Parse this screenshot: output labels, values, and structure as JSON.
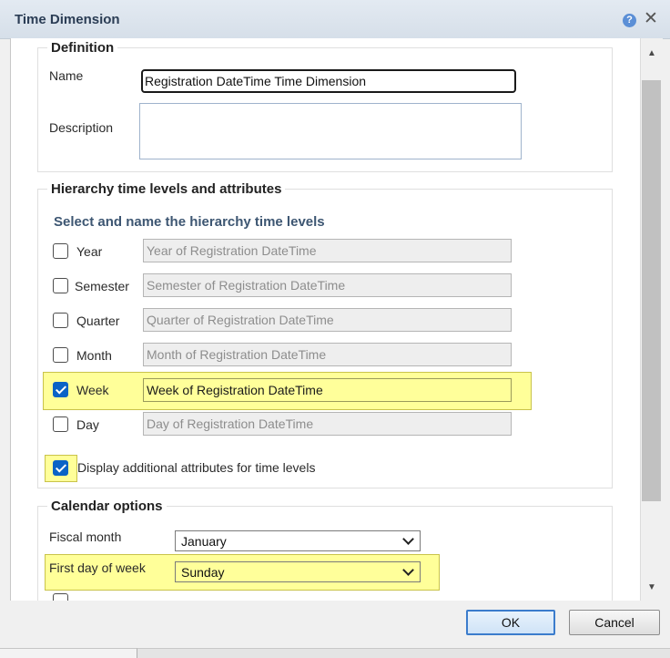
{
  "window": {
    "title": "Time Dimension"
  },
  "definition": {
    "legend": "Definition",
    "name_label": "Name",
    "name_value": "Registration DateTime Time Dimension",
    "description_label": "Description",
    "description_value": ""
  },
  "hierarchy": {
    "legend": "Hierarchy time levels and attributes",
    "subheading": "Select and name the hierarchy time levels",
    "levels": [
      {
        "label": "Year",
        "value": "Year of Registration DateTime",
        "checked": false
      },
      {
        "label": "Semester",
        "value": "Semester of Registration DateTime",
        "checked": false
      },
      {
        "label": "Quarter",
        "value": "Quarter of Registration DateTime",
        "checked": false
      },
      {
        "label": "Month",
        "value": "Month of Registration DateTime",
        "checked": false
      },
      {
        "label": "Week",
        "value": "Week of Registration DateTime",
        "checked": true
      },
      {
        "label": "Day",
        "value": "Day of Registration DateTime",
        "checked": false
      }
    ],
    "additional_attributes_label": "Display additional attributes for time levels",
    "additional_attributes_checked": true
  },
  "calendar": {
    "legend": "Calendar options",
    "fiscal_month_label": "Fiscal month",
    "fiscal_month_value": "January",
    "first_day_label": "First day of week",
    "first_day_value": "Sunday"
  },
  "buttons": {
    "ok": "OK",
    "cancel": "Cancel"
  },
  "colors": {
    "highlight": "#ffff99",
    "checkbox_checked": "#0a63c6"
  },
  "icons": [
    "help-icon",
    "close-icon",
    "scroll-up-arrow-icon",
    "scroll-down-arrow-icon",
    "chevron-down-icon"
  ]
}
